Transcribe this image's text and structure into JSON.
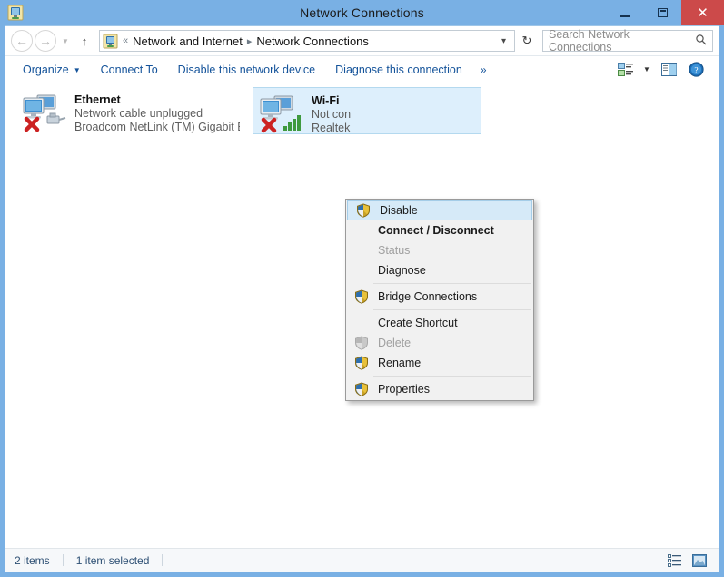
{
  "window": {
    "title": "Network Connections",
    "app_icon": "network-connections-icon",
    "controls": {
      "minimize": "minimize-button",
      "maximize": "maximize-button",
      "close": "close-button"
    },
    "frame_color": "#79b0e4",
    "close_color": "#cc4a4a"
  },
  "address_bar": {
    "back": "back-button",
    "forward": "forward-button",
    "history": "recent-locations-button",
    "up": "up-button",
    "refresh": "refresh-button",
    "crumb_icon": "network-folder-icon",
    "separator_first": "«",
    "crumbs": [
      "Network and Internet",
      "Network Connections"
    ],
    "crumb_arrow": "▸",
    "dropdown_caret": "⌄"
  },
  "search": {
    "placeholder": "Search Network Connections",
    "value": "",
    "icon": "search-icon"
  },
  "toolbar": {
    "items": [
      {
        "label": "Organize",
        "has_caret": true
      },
      {
        "label": "Connect To",
        "has_caret": false
      },
      {
        "label": "Disable this network device",
        "has_caret": false
      },
      {
        "label": "Diagnose this connection",
        "has_caret": false
      }
    ],
    "overflow_label": "»",
    "right_icons": [
      "change-view-icon",
      "view-dropdown-caret",
      "preview-pane-icon",
      "help-icon"
    ]
  },
  "connections": [
    {
      "name": "Ethernet",
      "status": "Network cable unplugged",
      "device": "Broadcom NetLink (TM) Gigabit E...",
      "selected": false,
      "badge": "red-x-badge",
      "secondary_icon": "cable-icon"
    },
    {
      "name": "Wi-Fi",
      "status": "Not con",
      "device": "Realtek",
      "selected": true,
      "badge": "red-x-badge",
      "secondary_icon": "signal-bars-icon"
    }
  ],
  "context_menu": {
    "items": [
      {
        "label": "Disable",
        "icon": "uac-shield-icon",
        "highlighted": true,
        "bold": false,
        "disabled": false
      },
      {
        "label": "Connect / Disconnect",
        "icon": "",
        "highlighted": false,
        "bold": true,
        "disabled": false
      },
      {
        "label": "Status",
        "icon": "",
        "highlighted": false,
        "bold": false,
        "disabled": true
      },
      {
        "label": "Diagnose",
        "icon": "",
        "highlighted": false,
        "bold": false,
        "disabled": false
      },
      {
        "separator": true
      },
      {
        "label": "Bridge Connections",
        "icon": "uac-shield-icon",
        "highlighted": false,
        "bold": false,
        "disabled": false
      },
      {
        "separator": true
      },
      {
        "label": "Create Shortcut",
        "icon": "",
        "highlighted": false,
        "bold": false,
        "disabled": false
      },
      {
        "label": "Delete",
        "icon": "uac-shield-icon-disabled",
        "highlighted": false,
        "bold": false,
        "disabled": true
      },
      {
        "label": "Rename",
        "icon": "uac-shield-icon",
        "highlighted": false,
        "bold": false,
        "disabled": false
      },
      {
        "separator": true
      },
      {
        "label": "Properties",
        "icon": "uac-shield-icon",
        "highlighted": false,
        "bold": false,
        "disabled": false
      }
    ],
    "highlight_color": "#d6eaf8"
  },
  "status_bar": {
    "item_count": "2 items",
    "selection": "1 item selected",
    "view_buttons": [
      "details-view-icon",
      "large-icons-view-icon"
    ]
  }
}
